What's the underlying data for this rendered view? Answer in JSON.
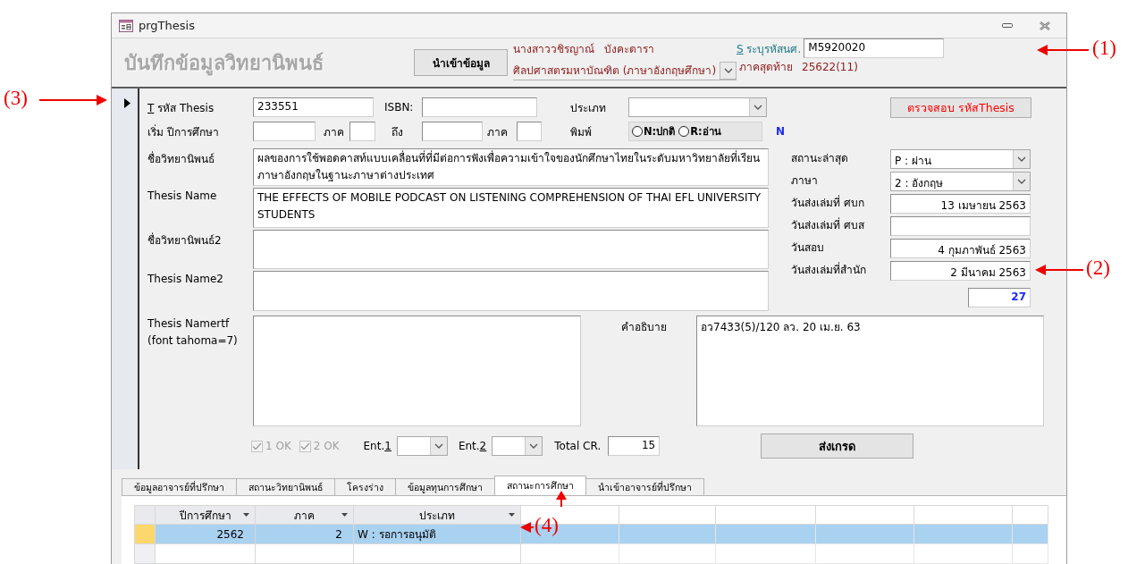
{
  "window": {
    "title": "prgThesis"
  },
  "header": {
    "title": "บันทึกข้อมูลวิทยานิพนธ์",
    "import_button": "นำเข้าข้อมูล",
    "student_name": "นางสาววชิรญาณ์   บังคะดารา",
    "program": "ศิลปศาสตรมหาบัณฑิต (ภาษาอังกฤษศึกษา)",
    "student_id": {
      "hotkey_prefix": "S",
      "label": "ระบุรหัสนศ.",
      "value": "M5920020"
    },
    "last_term": {
      "label": "ภาคสุดท้าย",
      "value": "25622(11)"
    }
  },
  "detail": {
    "thesis_id": {
      "hotkey_prefix": "T",
      "label": "รหัส Thesis",
      "value": "233551"
    },
    "isbn": {
      "label": "ISBN:"
    },
    "type": {
      "label": "ประเภท"
    },
    "check_button": "ตรวจสอบ รหัสThesis",
    "start_year": {
      "label": "เริ่ม ปีการศึกษา"
    },
    "start_term": {
      "label": "ภาค"
    },
    "end_year": {
      "label": "ถึง"
    },
    "end_term": {
      "label": "ภาค"
    },
    "print": {
      "label": "พิมพ์",
      "options": [
        {
          "label": "N:ปกติ",
          "selected": false
        },
        {
          "label": "R:อ่าน",
          "selected": false
        }
      ],
      "code": "N"
    },
    "text_fields": [
      {
        "label": "ชื่อวิทยานิพนธ์",
        "value": "ผลของการใช้พอดคาสท์แบบเคลื่อนที่ที่มีต่อการฟังเพื่อความเข้าใจของนักศึกษาไทยในระดับมหาวิทยาลัยที่เรียนภาษาอังกฤษในฐานะภาษาต่างประเทศ"
      },
      {
        "label": "Thesis Name",
        "value": "THE EFFECTS OF MOBILE PODCAST ON LISTENING COMPREHENSION OF THAI EFL UNIVERSITY STUDENTS"
      },
      {
        "label": "ชื่อวิทยานิพนธ์2"
      },
      {
        "label": "Thesis Name2"
      }
    ],
    "status_fields": [
      {
        "kind": "combo",
        "label": "สถานะล่าสุด",
        "value": "P : ผ่าน"
      },
      {
        "kind": "combo",
        "label": "ภาษา",
        "value": "2 : อังกฤษ"
      },
      {
        "kind": "date",
        "label": "วันส่งเล่มที่ ศบก",
        "value": "13 เมษายน 2563"
      },
      {
        "kind": "date",
        "label": "วันส่งเล่มที่ ศบส"
      },
      {
        "kind": "date",
        "label": "วันสอบ",
        "value": "4 กุมภาพันธ์ 2563"
      },
      {
        "kind": "date",
        "label": "วันส่งเล่มที่สำนัก",
        "value": "2 มีนาคม 2563"
      }
    ],
    "day_count": "27",
    "rtf": {
      "label_lines": [
        "Thesis Namertf",
        "(font tahoma=7)"
      ]
    },
    "description": {
      "label": "คำอธิบาย",
      "value": "อว7433(5)/120 ลว. 20 เม.ย. 63"
    },
    "ok_checks": [
      {
        "label": "1 OK",
        "checked": true,
        "disabled": true
      },
      {
        "label": "2 OK",
        "checked": true,
        "disabled": true
      }
    ],
    "ent": [
      {
        "label": "Ent.",
        "hotkey_suffix": "1"
      },
      {
        "label": "Ent.",
        "hotkey_suffix": "2"
      }
    ],
    "total_cr": {
      "label": "Total CR.",
      "value": "15"
    },
    "grade_button": "ส่งเกรด"
  },
  "tabs": [
    {
      "label": "ข้อมูลอาจารย์ที่ปรึกษา",
      "selected": false
    },
    {
      "label": "สถานะวิทยานิพนธ์",
      "selected": false
    },
    {
      "label": "โครงร่าง",
      "selected": false
    },
    {
      "label": "ข้อมูลทุนการศึกษา",
      "selected": false
    },
    {
      "label": "สถานะการศึกษา",
      "selected": true
    },
    {
      "label": "นำเข้าอาจารย์ที่ปรึกษา",
      "selected": false
    }
  ],
  "grid": {
    "columns": [
      "ปีการศึกษา",
      "ภาค",
      "ประเภท"
    ],
    "rows": [
      {
        "cells": [
          "2562",
          "2",
          "W : รอการอนุมัติ"
        ],
        "selected": true
      }
    ]
  },
  "annotations": [
    {
      "label": "(1)"
    },
    {
      "label": "(2)"
    },
    {
      "label": "(3)"
    },
    {
      "label": "(4)"
    }
  ]
}
